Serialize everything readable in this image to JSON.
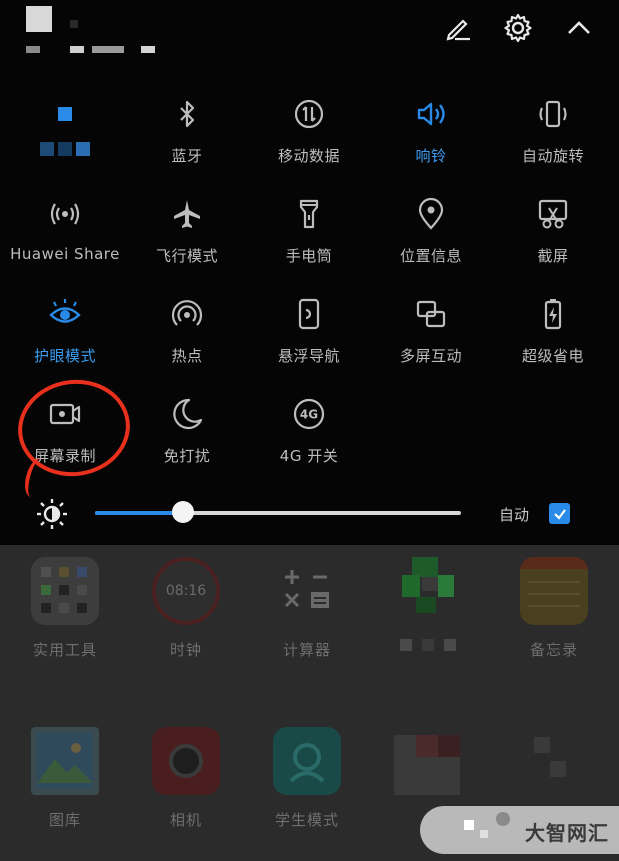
{
  "tiles": [
    {
      "label": "",
      "icon": "mosaic-icon",
      "active": false
    },
    {
      "label": "蓝牙",
      "icon": "bluetooth-icon",
      "active": false
    },
    {
      "label": "移动数据",
      "icon": "mobile-data-icon",
      "active": false
    },
    {
      "label": "响铃",
      "icon": "ring-icon",
      "active": true
    },
    {
      "label": "自动旋转",
      "icon": "auto-rotate-icon",
      "active": false
    },
    {
      "label": "Huawei Share",
      "icon": "huawei-share-icon",
      "active": false
    },
    {
      "label": "飞行模式",
      "icon": "airplane-icon",
      "active": false
    },
    {
      "label": "手电筒",
      "icon": "flashlight-icon",
      "active": false
    },
    {
      "label": "位置信息",
      "icon": "location-icon",
      "active": false
    },
    {
      "label": "截屏",
      "icon": "screenshot-icon",
      "active": false
    },
    {
      "label": "护眼模式",
      "icon": "eye-comfort-icon",
      "active": true
    },
    {
      "label": "热点",
      "icon": "hotspot-icon",
      "active": false
    },
    {
      "label": "悬浮导航",
      "icon": "floating-nav-icon",
      "active": false
    },
    {
      "label": "多屏互动",
      "icon": "multi-screen-icon",
      "active": false
    },
    {
      "label": "超级省电",
      "icon": "battery-saver-icon",
      "active": false
    },
    {
      "label": "屏幕录制",
      "icon": "screen-record-icon",
      "active": false
    },
    {
      "label": "免打扰",
      "icon": "do-not-disturb-icon",
      "active": false
    },
    {
      "label": "4G 开关",
      "icon": "4g-icon",
      "active": false
    }
  ],
  "four_g_text": "4G",
  "brightness": {
    "level": 0.24,
    "auto_label": "自动",
    "auto_checked": true
  },
  "accent_color": "#2a8ae8",
  "annotation_color": "#e8301c",
  "apps": [
    {
      "label": "实用工具",
      "icon": "tools-folder-icon"
    },
    {
      "label": "时钟",
      "icon": "clock-icon",
      "clock_text": "08:16"
    },
    {
      "label": "计算器",
      "icon": "calculator-icon"
    },
    {
      "label": "",
      "icon": "mosaic-app-icon"
    },
    {
      "label": "备忘录",
      "icon": "notes-icon"
    },
    {
      "label": "图库",
      "icon": "gallery-icon"
    },
    {
      "label": "相机",
      "icon": "camera-icon"
    },
    {
      "label": "学生模式",
      "icon": "student-mode-icon"
    },
    {
      "label": "",
      "icon": "mosaic-app-icon"
    },
    {
      "label": "",
      "icon": "mosaic-app-icon"
    }
  ],
  "watermark": "大智网汇"
}
